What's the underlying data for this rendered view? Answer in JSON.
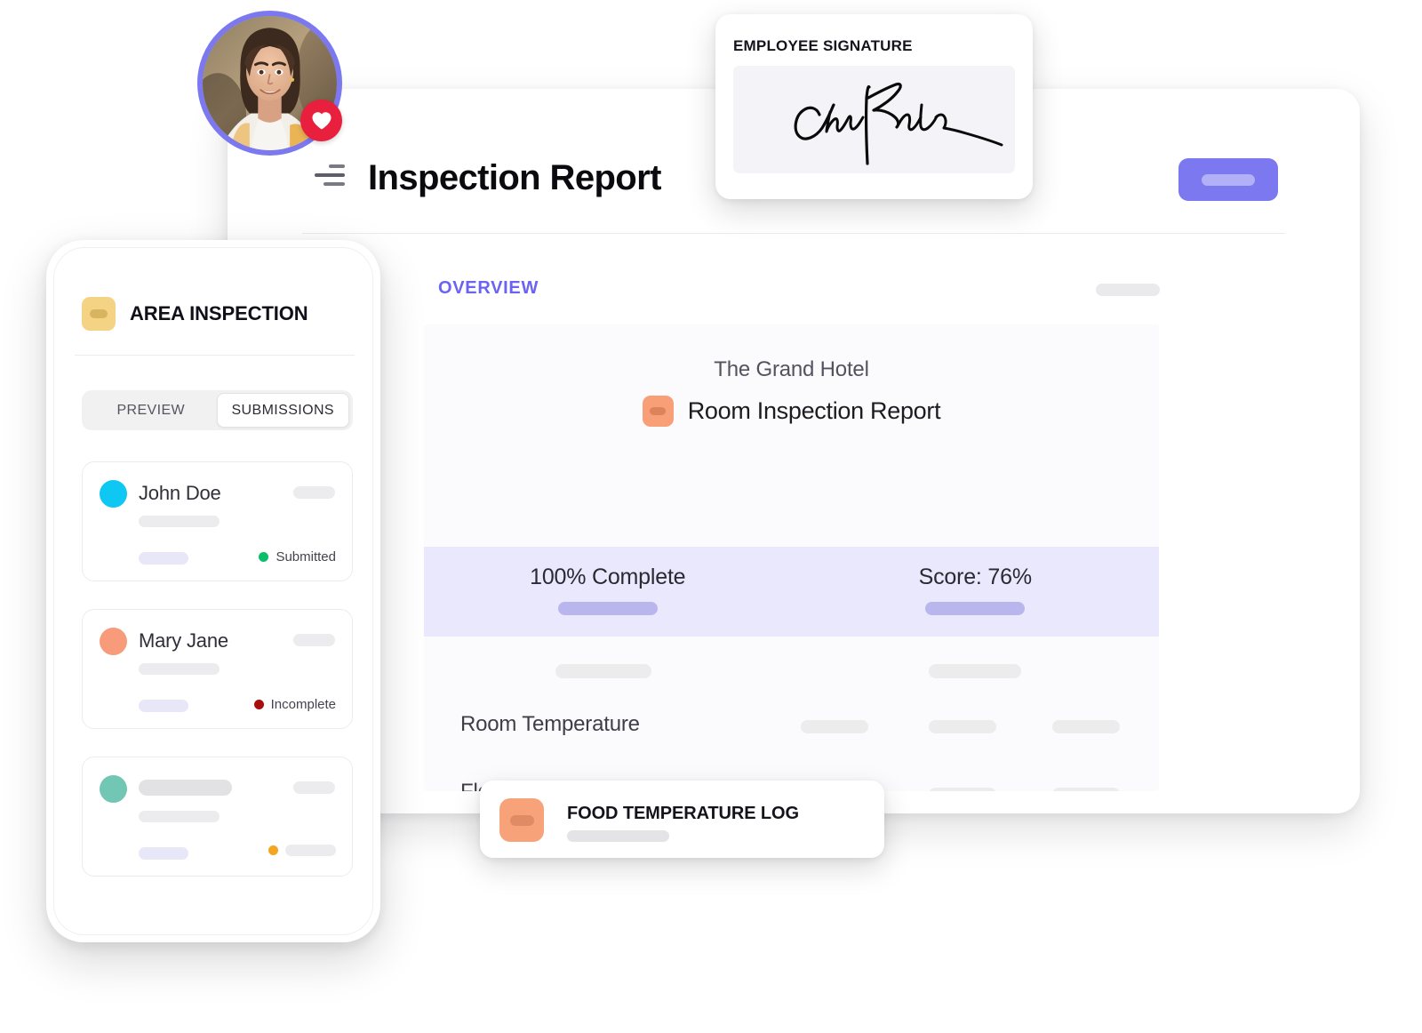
{
  "window": {
    "title": "Inspection Report",
    "menu_icon": "hamburger-menu-icon",
    "action_button_label": ""
  },
  "overview": {
    "section_label": "OVERVIEW",
    "card": {
      "organization": "The Grand Hotel",
      "report_title": "Room Inspection Report",
      "badge_icon": "form-badge-icon",
      "stats": [
        {
          "value": "100% Complete"
        },
        {
          "value": "Score: 76%"
        }
      ],
      "rows": [
        {
          "label": "Room Temperature",
          "status": "pending"
        },
        {
          "label": "Floor",
          "status": "ok"
        }
      ]
    }
  },
  "phone": {
    "title": "AREA INSPECTION",
    "badge_icon": "form-badge-icon",
    "tabs": [
      {
        "label": "PREVIEW",
        "active": false
      },
      {
        "label": "SUBMISSIONS",
        "active": true
      }
    ],
    "submissions": [
      {
        "name": "John Doe",
        "status": "Submitted",
        "dot_color": "#0ec7f2",
        "status_color": "#0bbf6a"
      },
      {
        "name": "Mary Jane",
        "status": "Incomplete",
        "dot_color": "#f79b7a",
        "status_color": "#a90d0d"
      },
      {
        "name": "",
        "status": "",
        "dot_color": "#72c6b4",
        "status_color": "#f5a524"
      }
    ]
  },
  "signature": {
    "title": "EMPLOYEE SIGNATURE",
    "pad_icon": "handwritten-signature"
  },
  "food_log": {
    "title": "FOOD TEMPERATURE LOG",
    "badge_icon": "form-badge-icon"
  },
  "avatar": {
    "name": "user-avatar",
    "badge_icon": "heart-icon",
    "ring_color": "#7b78f0",
    "badge_color": "#e8203e"
  },
  "colors": {
    "accent": "#7b78f0",
    "overview_label": "#6c63f3",
    "stat_band": "#e9e8fc",
    "ok_green": "#7ccfb8",
    "orange_badge": "#f8a279",
    "yellow_badge": "#f4d484"
  }
}
